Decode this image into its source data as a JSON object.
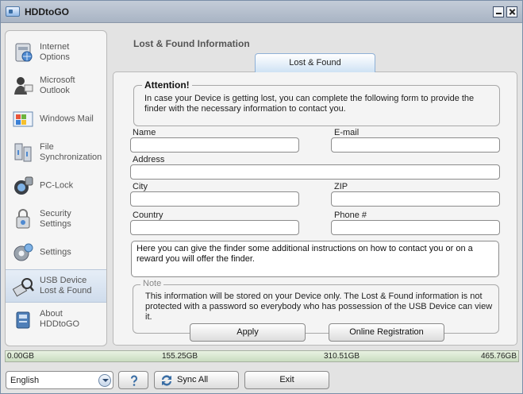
{
  "window": {
    "title": "HDDtoGO"
  },
  "sidebar": {
    "items": [
      {
        "label": "Internet\nOptions",
        "icon": "internet-options-icon"
      },
      {
        "label": "Microsoft\nOutlook",
        "icon": "outlook-icon"
      },
      {
        "label": "Windows Mail",
        "icon": "windows-mail-icon"
      },
      {
        "label": "File\nSynchronization",
        "icon": "file-sync-icon"
      },
      {
        "label": "PC-Lock",
        "icon": "pc-lock-icon"
      },
      {
        "label": "Security\nSettings",
        "icon": "security-settings-icon"
      },
      {
        "label": "Settings",
        "icon": "settings-gear-icon"
      },
      {
        "label": "USB Device\nLost & Found",
        "icon": "usb-lost-found-icon",
        "active": true
      },
      {
        "label": "About\nHDDtoGO",
        "icon": "about-icon"
      }
    ]
  },
  "main": {
    "heading": "Lost & Found Information",
    "tab": "Lost & Found",
    "attention": {
      "title": "Attention!",
      "text": "In case your Device is getting lost, you can complete the following form to provide the finder with the necessary information to contact you."
    },
    "form": {
      "name_label": "Name",
      "email_label": "E-mail",
      "address_label": "Address",
      "city_label": "City",
      "zip_label": "ZIP",
      "country_label": "Country",
      "phone_label": "Phone #",
      "name_value": "",
      "email_value": "",
      "address_value": "",
      "city_value": "",
      "zip_value": "",
      "country_value": "",
      "phone_value": "",
      "instructions": "Here you can give the finder some additional instructions on how to contact you or on a reward you will offer the finder."
    },
    "note": {
      "title": "Note",
      "text": "This information will be stored on your Device only. The Lost & Found information is not protected with a password so everybody who has possession of the USB Device can view it."
    },
    "buttons": {
      "apply": "Apply",
      "online_registration": "Online Registration"
    }
  },
  "capacity": {
    "ticks": [
      "0.00GB",
      "155.25GB",
      "310.51GB",
      "465.76GB"
    ],
    "used_fraction": 0.0
  },
  "footer": {
    "language": "English",
    "help_icon": "question-mark-icon",
    "sync_all": "Sync All",
    "exit": "Exit"
  }
}
